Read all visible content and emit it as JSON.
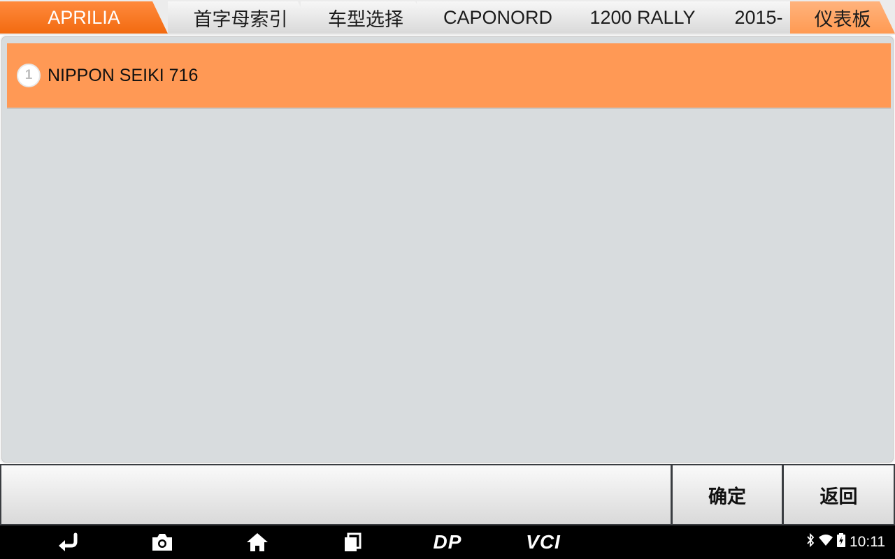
{
  "breadcrumbs": [
    {
      "label": "APRILIA",
      "state": "active"
    },
    {
      "label": "首字母索引",
      "state": "normal"
    },
    {
      "label": "车型选择",
      "state": "normal"
    },
    {
      "label": "CAPONORD",
      "state": "normal"
    },
    {
      "label": "1200 RALLY",
      "state": "normal"
    },
    {
      "label": "2015-",
      "state": "normal"
    },
    {
      "label": "仪表板",
      "state": "current"
    }
  ],
  "list": {
    "items": [
      {
        "index": "1",
        "label": "NIPPON SEIKI 716",
        "selected": true
      }
    ]
  },
  "buttons": {
    "confirm_label": "确定",
    "back_label": "返回"
  },
  "navbar": {
    "icons": [
      "back-arrow-icon",
      "camera-icon",
      "home-icon",
      "recent-apps-icon"
    ],
    "dp_label": "DP",
    "vci_label": "VCI"
  },
  "status": {
    "time": "10:11",
    "icons": [
      "bluetooth-icon",
      "wifi-icon",
      "battery-icon"
    ]
  },
  "colors": {
    "accent": "#f26a10",
    "selected_row": "#ff9955",
    "current_crumb": "#ffa566",
    "panel_bg": "#d8dcde"
  }
}
